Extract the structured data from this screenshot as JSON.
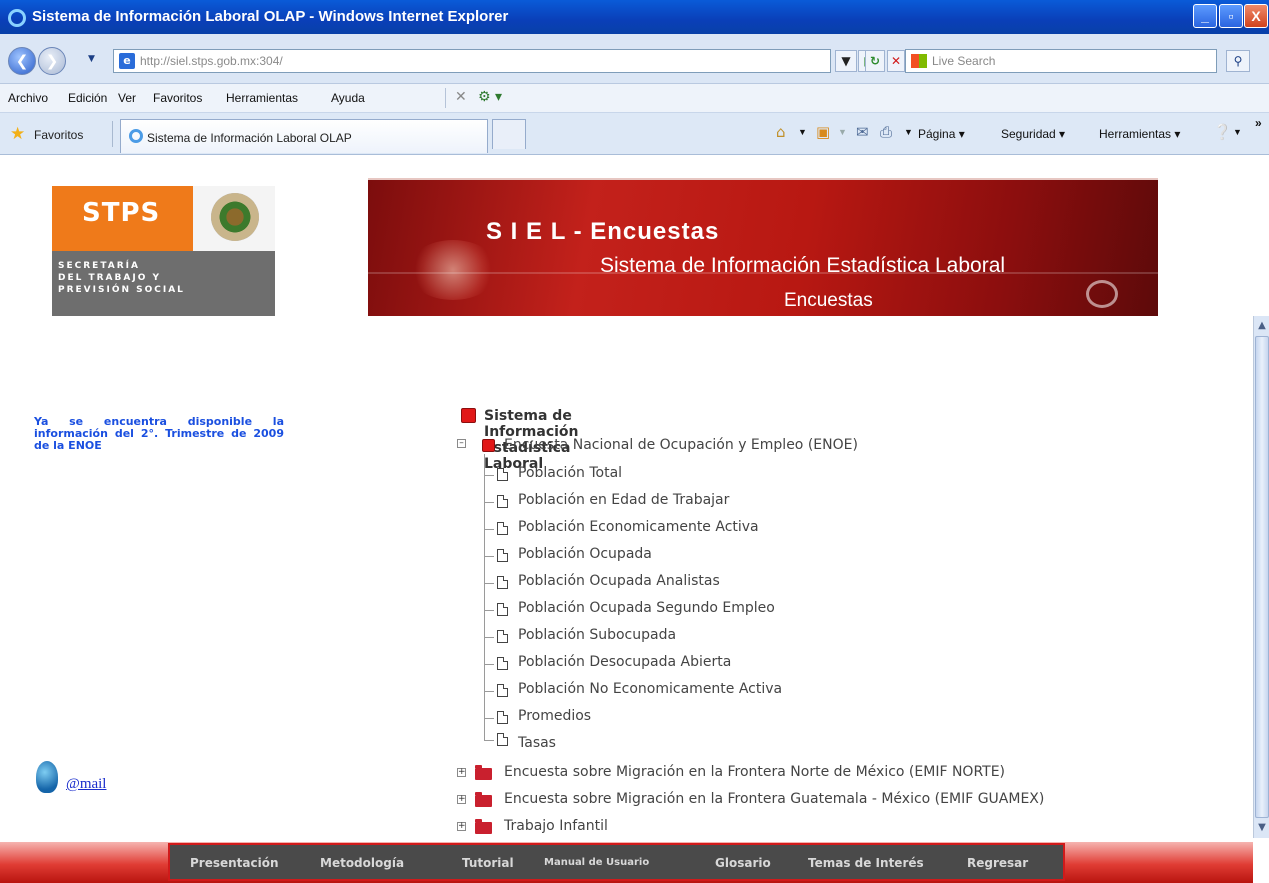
{
  "window": {
    "title": "Sistema de Información Laboral OLAP - Windows Internet Explorer",
    "min": "_",
    "max": "▫",
    "close": "X"
  },
  "address": {
    "url": "http://siel.stps.gob.mx:304/",
    "search_placeholder": "Live Search"
  },
  "menu": [
    "Archivo",
    "Edición",
    "Ver",
    "Favoritos",
    "Herramientas",
    "Ayuda"
  ],
  "favorites": {
    "label": "Favoritos",
    "tab_label": "Sistema de Información Laboral OLAP",
    "commands": [
      "Página",
      "Seguridad",
      "Herramientas"
    ]
  },
  "logo": {
    "acronym": "STPS",
    "lines": [
      "SECRETARÍA",
      "DEL TRABAJO Y",
      "PREVISIÓN SOCIAL"
    ]
  },
  "banner": {
    "title": "S I E L - Encuestas",
    "subtitle": "Sistema de Información Estadística Laboral",
    "subtitle2": "Encuestas"
  },
  "notice": "Ya se encuentra disponible la información del 2°. Trimestre de 2009 de la ENOE",
  "mail": "@mail",
  "tree": {
    "root": "Sistema de Información Estadística Laboral",
    "enoe": "Encuesta Nacional de Ocupación y Empleo (ENOE)",
    "enoe_items": [
      "Población Total",
      "Población en Edad de Trabajar",
      "Población Economicamente Activa",
      "Población Ocupada",
      "Población Ocupada Analistas",
      "Población Ocupada Segundo Empleo",
      "Población Subocupada",
      "Población Desocupada Abierta",
      "Población No Economicamente Activa",
      "Promedios",
      "Tasas"
    ],
    "collapsed": [
      "Encuesta sobre Migración en la Frontera Norte de México (EMIF NORTE)",
      "Encuesta sobre Migración en la Frontera Guatemala - México (EMIF GUAMEX)",
      "Trabajo Infantil"
    ]
  },
  "bottom_nav": [
    "Presentación",
    "Metodología",
    "Tutorial",
    "Manual de Usuario",
    "Glosario",
    "Temas de Interés",
    "Regresar"
  ]
}
